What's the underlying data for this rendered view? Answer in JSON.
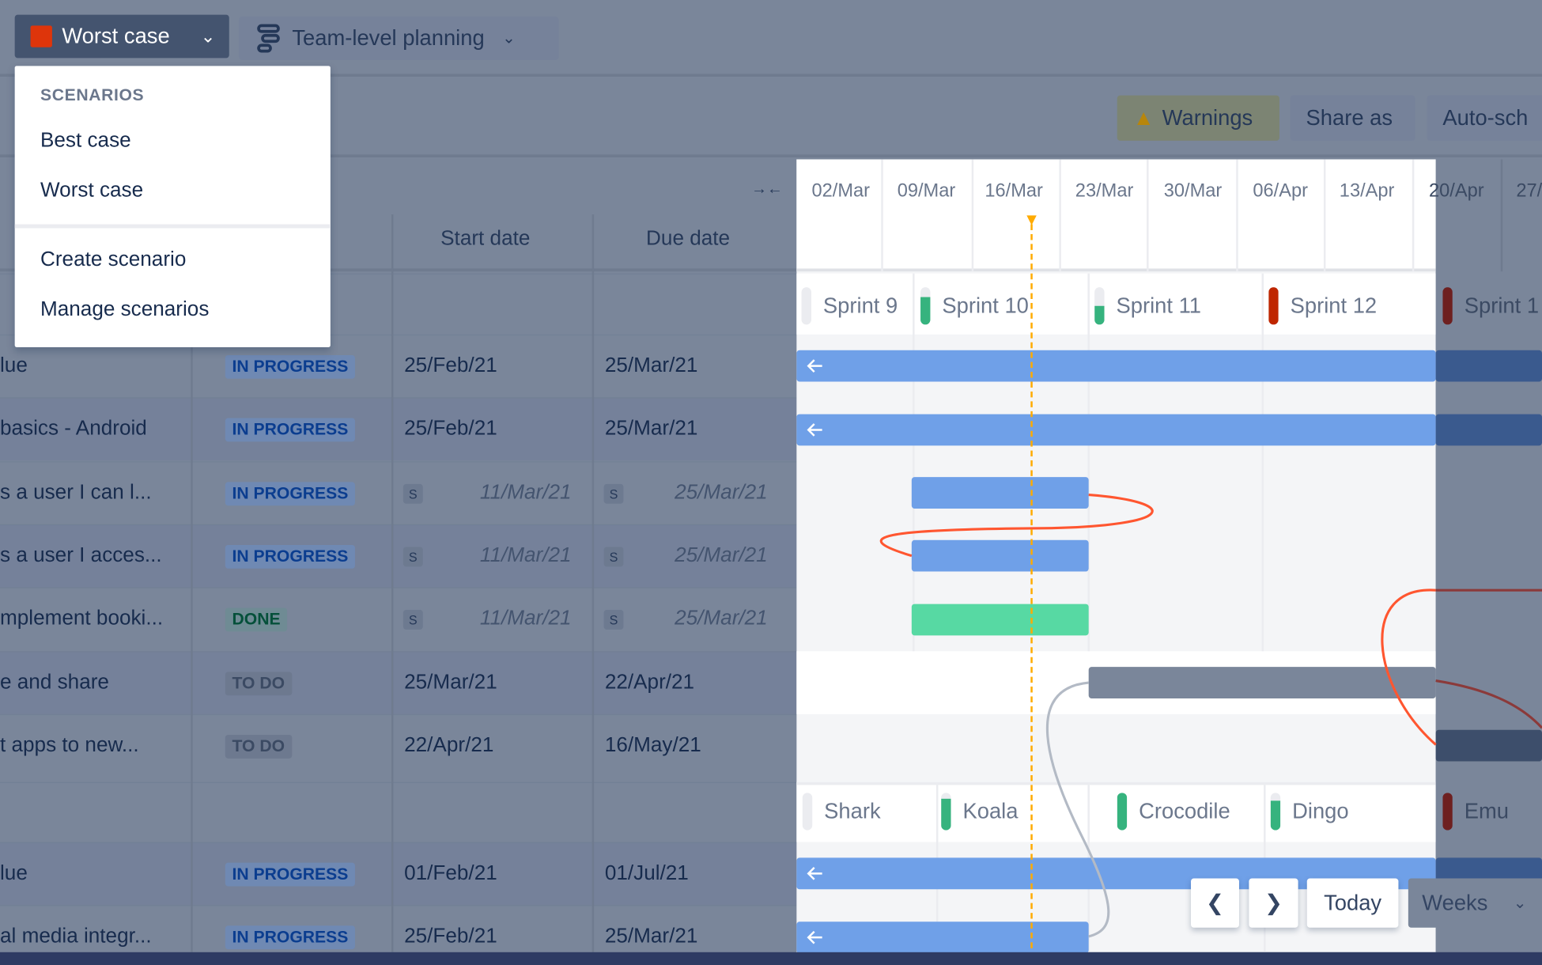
{
  "toolbar": {
    "scenario": "Worst case",
    "scenario_color": "#de350b",
    "planning": "Team-level planning",
    "warnings": "Warnings",
    "share": "Share as",
    "auto": "Auto-sch"
  },
  "menu": {
    "heading": "SCENARIOS",
    "items": [
      "Best case",
      "Worst case"
    ],
    "actions": [
      "Create scenario",
      "Manage scenarios"
    ]
  },
  "table": {
    "headers": {
      "start": "Start date",
      "due": "Due date"
    },
    "rows": [
      {
        "title": "lue",
        "status": "IN PROGRESS",
        "start": "25/Feb/21",
        "due": "25/Mar/21",
        "inferred": false
      },
      {
        "title": "basics - Android",
        "status": "IN PROGRESS",
        "start": "25/Feb/21",
        "due": "25/Mar/21",
        "inferred": false
      },
      {
        "title": "s a user I can l...",
        "status": "IN PROGRESS",
        "start": "11/Mar/21",
        "due": "25/Mar/21",
        "inferred": true
      },
      {
        "title": "s a user I acces...",
        "status": "IN PROGRESS",
        "start": "11/Mar/21",
        "due": "25/Mar/21",
        "inferred": true
      },
      {
        "title": "mplement booki...",
        "status": "DONE",
        "start": "11/Mar/21",
        "due": "25/Mar/21",
        "inferred": true
      },
      {
        "title": "e and share",
        "status": "TO DO",
        "start": "25/Mar/21",
        "due": "22/Apr/21",
        "inferred": false
      },
      {
        "title": "t apps to new...",
        "status": "TO DO",
        "start": "22/Apr/21",
        "due": "16/May/21",
        "inferred": false
      },
      {
        "title": "lue",
        "status": "IN PROGRESS",
        "start": "01/Feb/21",
        "due": "01/Jul/21",
        "inferred": false
      },
      {
        "title": "al media integr...",
        "status": "IN PROGRESS",
        "start": "25/Feb/21",
        "due": "25/Mar/21",
        "inferred": false
      }
    ],
    "sprint_badge": "S"
  },
  "timeline": {
    "weeks": [
      "02/Mar",
      "09/Mar",
      "16/Mar",
      "23/Mar",
      "30/Mar",
      "06/Apr",
      "13/Apr",
      "20/Apr",
      "27/"
    ],
    "sprints": [
      {
        "name": "Sprint 9",
        "fill": 0,
        "color": "#36b37e"
      },
      {
        "name": "Sprint 10",
        "fill": 0.75,
        "color": "#36b37e"
      },
      {
        "name": "Sprint 11",
        "fill": 0.5,
        "color": "#36b37e"
      },
      {
        "name": "Sprint 12",
        "fill": 1,
        "color": "#bf2600"
      },
      {
        "name": "Sprint 1",
        "fill": 1,
        "color": "#6e2020"
      }
    ],
    "teams": [
      {
        "name": "Shark",
        "fill": 0,
        "color": "#36b37e"
      },
      {
        "name": "Koala",
        "fill": 0.85,
        "color": "#36b37e"
      },
      {
        "name": "Crocodile",
        "fill": 1,
        "color": "#36b37e"
      },
      {
        "name": "Dingo",
        "fill": 0.8,
        "color": "#36b37e"
      },
      {
        "name": "Emu",
        "fill": 1,
        "color": "#6e2020"
      }
    ],
    "today_color": "#ffab00",
    "nav": {
      "today": "Today",
      "zoom": "Weeks"
    }
  }
}
